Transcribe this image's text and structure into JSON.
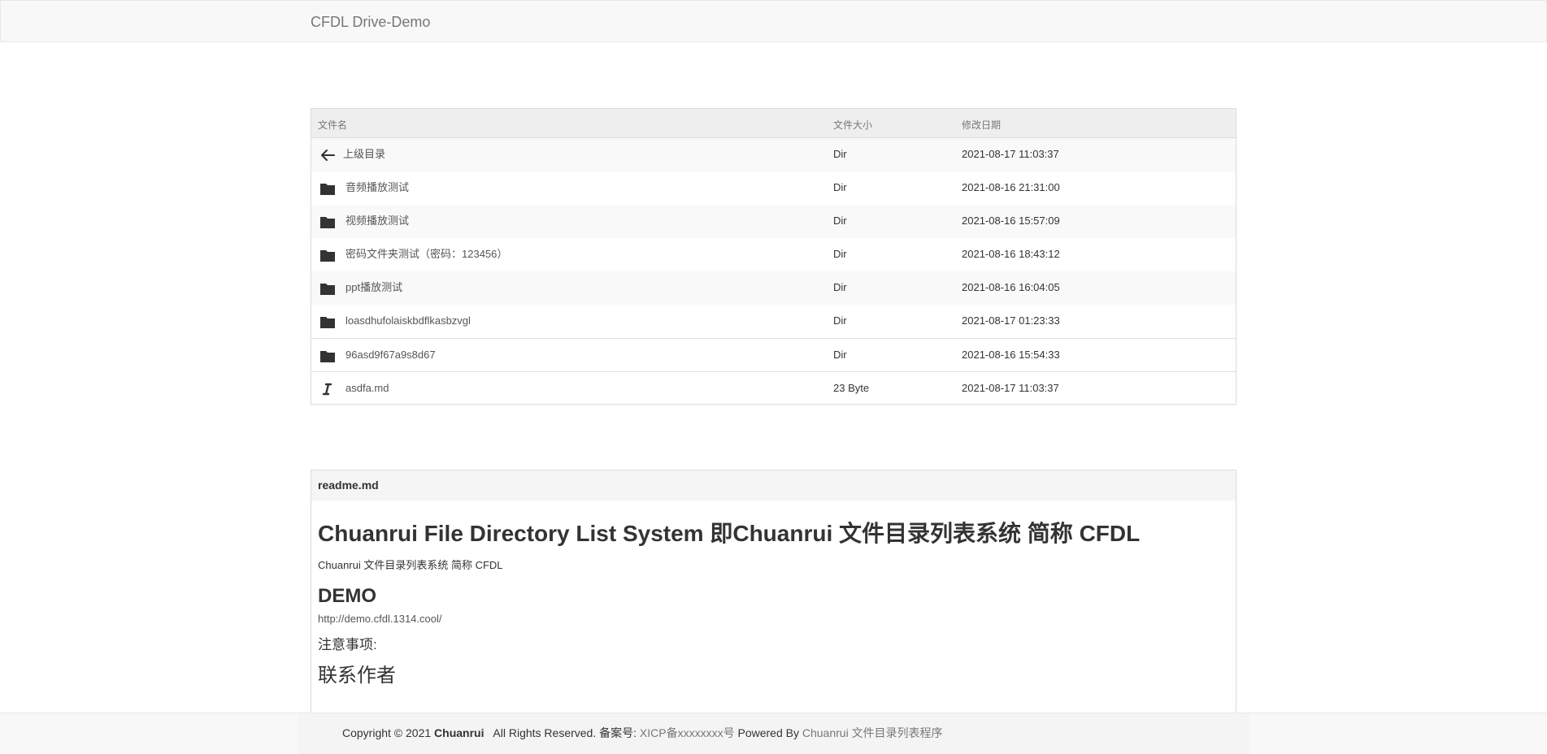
{
  "navbar": {
    "brand": "CFDL Drive-Demo"
  },
  "table": {
    "headers": {
      "name": "文件名",
      "size": "文件大小",
      "date": "修改日期"
    },
    "rows": [
      {
        "name": "上级目录",
        "size": "Dir",
        "date": "2021-08-17 11:03:37",
        "icon": "arrow-left-icon"
      },
      {
        "name": "音频播放测试",
        "size": "Dir",
        "date": "2021-08-16 21:31:00",
        "icon": "folder-icon"
      },
      {
        "name": "视频播放测试",
        "size": "Dir",
        "date": "2021-08-16 15:57:09",
        "icon": "folder-icon"
      },
      {
        "name": "密码文件夹测试（密码：123456）",
        "size": "Dir",
        "date": "2021-08-16 18:43:12",
        "icon": "folder-icon"
      },
      {
        "name": "ppt播放测试",
        "size": "Dir",
        "date": "2021-08-16 16:04:05",
        "icon": "folder-icon"
      },
      {
        "name": "loasdhufolaiskbdflkasbzvgl",
        "size": "Dir",
        "date": "2021-08-17 01:23:33",
        "icon": "folder-icon"
      },
      {
        "name": "96asd9f67a9s8d67",
        "size": "Dir",
        "date": "2021-08-16 15:54:33",
        "icon": "folder-icon"
      },
      {
        "name": "asdfa.md",
        "size": "23 Byte",
        "date": "2021-08-17 11:03:37",
        "icon": "italic-file-icon"
      }
    ]
  },
  "readme": {
    "title": "readme.md",
    "h1": "Chuanrui File Directory List System 即Chuanrui 文件目录列表系统 简称 CFDL",
    "p1": "Chuanrui 文件目录列表系统 简称 CFDL",
    "h2_demo": "DEMO",
    "demo_link": "http://demo.cfdl.1314.cool/",
    "note": "注意事项:",
    "h2_contact": "联系作者"
  },
  "footer": {
    "copyright": "Copyright © 2021",
    "owner": "Chuanrui",
    "rights": "All Rights Reserved.",
    "beian_label": "备案号:",
    "beian_value": "XICP备xxxxxxxx号",
    "powered_label": "Powered By",
    "powered_value": "Chuanrui 文件目录列表程序"
  },
  "colors": {
    "navbar_bg": "#f8f8f8",
    "header_bg": "#eeeeee",
    "odd_row_bg": "#f9f9f9",
    "text": "#333333",
    "muted": "#777777"
  }
}
